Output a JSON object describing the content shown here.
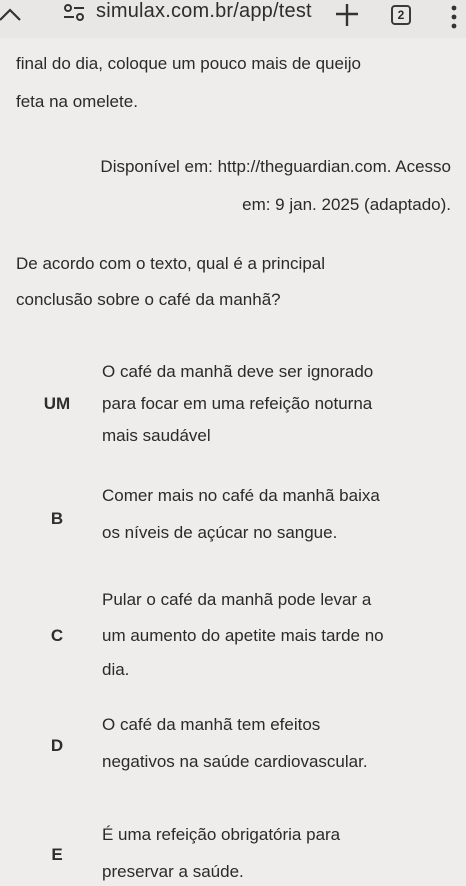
{
  "browser": {
    "url": "simulax.com.br/app/test",
    "tab_count": "2",
    "home_icon": "home-icon",
    "site_icon": "site-settings-icon",
    "new_tab_icon": "plus-icon",
    "menu_icon": "more-vertical-icon"
  },
  "passage": {
    "line1": "final do dia, coloque um pouco mais de queijo",
    "line2": "feta na omelete."
  },
  "source": {
    "line1": "Disponível em: http://theguardian.com. Acesso",
    "line2": "em: 9 jan. 2025 (adaptado)."
  },
  "question": {
    "line1": "De acordo com o texto, qual é a principal",
    "line2": "conclusão sobre o café da manhã?"
  },
  "options": [
    {
      "letter": "UM",
      "lines": [
        "O café da manhã deve ser ignorado",
        "para focar em uma refeição noturna",
        "mais saudável"
      ]
    },
    {
      "letter": "B",
      "lines": [
        "Comer mais no café da manhã baixa",
        "os níveis de açúcar no sangue."
      ]
    },
    {
      "letter": "C",
      "lines": [
        "Pular o café da manhã pode levar a",
        "um aumento do apetite mais tarde no",
        "dia."
      ]
    },
    {
      "letter": "D",
      "lines": [
        "O café da manhã tem efeitos",
        "negativos na saúde cardiovascular."
      ]
    },
    {
      "letter": "E",
      "lines": [
        "É uma refeição obrigatória para",
        "preservar a saúde."
      ]
    }
  ]
}
